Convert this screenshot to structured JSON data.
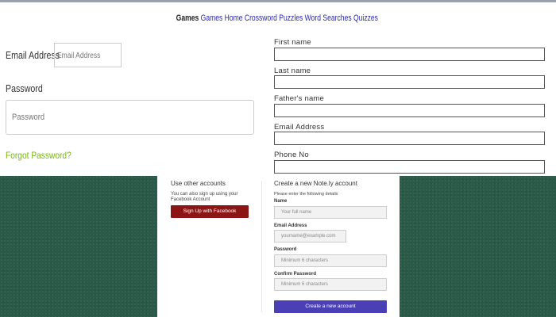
{
  "nav": {
    "brand": "Games",
    "links": [
      "Games",
      "Home",
      "Crossword Puzzles",
      "Word Searches",
      "Quizzes"
    ]
  },
  "login": {
    "email_label": "Email Address",
    "email_placeholder": "Email Address",
    "password_label": "Password",
    "password_placeholder": "Password",
    "forgot_link": "Forgot Password?"
  },
  "register_top": {
    "first_name_label": "First name",
    "last_name_label": "Last name",
    "fathers_name_label": "Father's name",
    "email_label": "Email Address",
    "phone_label": "Phone No"
  },
  "other_accounts": {
    "title": "Use other accounts",
    "description_line1": "You can also sign up using your",
    "description_line2": "Facebook Account",
    "facebook_button": "Sign Up with Facebook"
  },
  "create_account": {
    "title": "Create a new Note.ly account",
    "instructions": "Please enter the following details",
    "name_label": "Name",
    "name_placeholder": "Your full name",
    "email_label": "Email Address",
    "email_placeholder": "yourname@example.com",
    "password_label": "Password",
    "password_placeholder": "Minimum 6 characters",
    "confirm_label": "Confirm Password",
    "confirm_placeholder": "Minimum 6 characters",
    "submit_button": "Create a new account"
  },
  "colors": {
    "felt_green": "#2b5a49",
    "facebook_button": "#8b1414",
    "submit_button": "#4b3fb5",
    "forgot_link": "#7bb31a",
    "nav_link": "#2a2aa8"
  }
}
